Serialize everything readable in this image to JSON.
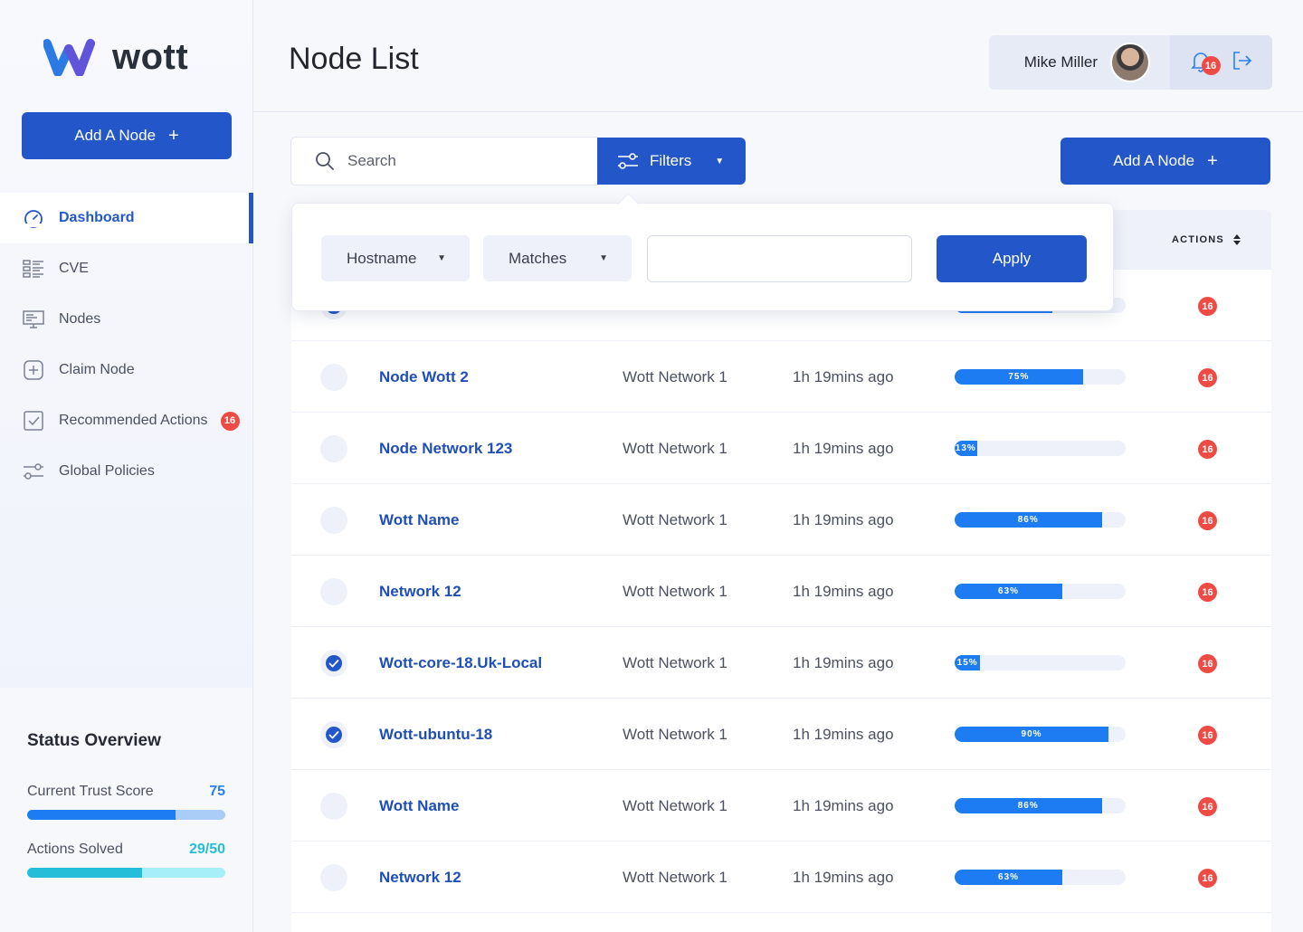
{
  "brand": {
    "name": "wott"
  },
  "sidebar": {
    "add_button": "Add A Node",
    "items": [
      {
        "label": "Dashboard",
        "icon": "gauge-icon",
        "active": true
      },
      {
        "label": "CVE",
        "icon": "list-icon"
      },
      {
        "label": "Nodes",
        "icon": "monitor-icon"
      },
      {
        "label": "Claim Node",
        "icon": "plus-square-icon"
      },
      {
        "label": "Recommended Actions",
        "icon": "checkbox-icon",
        "badge": "16"
      },
      {
        "label": "Global Policies",
        "icon": "sliders-icon"
      }
    ],
    "status": {
      "title": "Status Overview",
      "trust_label": "Current Trust Score",
      "trust_value": "75",
      "trust_fraction": 0.75,
      "actions_label": "Actions Solved",
      "actions_value": "29/50",
      "actions_fraction": 0.58
    }
  },
  "header": {
    "title": "Node List",
    "user_name": "Mike Miller",
    "notification_count": "16"
  },
  "toolbar": {
    "search_placeholder": "Search",
    "filters_label": "Filters",
    "add_button": "Add A Node"
  },
  "filter": {
    "field": "Hostname",
    "operator": "Matches",
    "value": "",
    "apply_label": "Apply"
  },
  "table": {
    "actions_header": "ACTIONS",
    "rows": [
      {
        "checked": true,
        "name": "",
        "network": "",
        "time": "",
        "progress": 0.57,
        "progress_label": "",
        "actions": "16"
      },
      {
        "checked": false,
        "name": "Node Wott 2",
        "network": "Wott Network 1",
        "time": "1h 19mins ago",
        "progress": 0.75,
        "progress_label": "75%",
        "actions": "16"
      },
      {
        "checked": false,
        "name": "Node Network 123",
        "network": "Wott Network 1",
        "time": "1h 19mins ago",
        "progress": 0.13,
        "progress_label": "13%",
        "actions": "16"
      },
      {
        "checked": false,
        "name": "Wott Name",
        "network": "Wott Network 1",
        "time": "1h 19mins ago",
        "progress": 0.86,
        "progress_label": "86%",
        "actions": "16"
      },
      {
        "checked": false,
        "name": "Network 12",
        "network": "Wott Network 1",
        "time": "1h 19mins ago",
        "progress": 0.63,
        "progress_label": "63%",
        "actions": "16"
      },
      {
        "checked": true,
        "name": "Wott-core-18.Uk-Local",
        "network": "Wott Network 1",
        "time": "1h 19mins ago",
        "progress": 0.15,
        "progress_label": "15%",
        "actions": "16"
      },
      {
        "checked": true,
        "name": "Wott-ubuntu-18",
        "network": "Wott Network 1",
        "time": "1h 19mins ago",
        "progress": 0.9,
        "progress_label": "90%",
        "actions": "16"
      },
      {
        "checked": false,
        "name": "Wott Name",
        "network": "Wott Network 1",
        "time": "1h 19mins ago",
        "progress": 0.86,
        "progress_label": "86%",
        "actions": "16"
      },
      {
        "checked": false,
        "name": "Network 12",
        "network": "Wott Network 1",
        "time": "1h 19mins ago",
        "progress": 0.63,
        "progress_label": "63%",
        "actions": "16"
      }
    ]
  },
  "colors": {
    "primary": "#2357c9",
    "progress": "#1d7cf2",
    "badge": "#ef4b45",
    "teal": "#25bed8",
    "light_blue": "#a9cdf7",
    "light_teal": "#a6eef8"
  }
}
